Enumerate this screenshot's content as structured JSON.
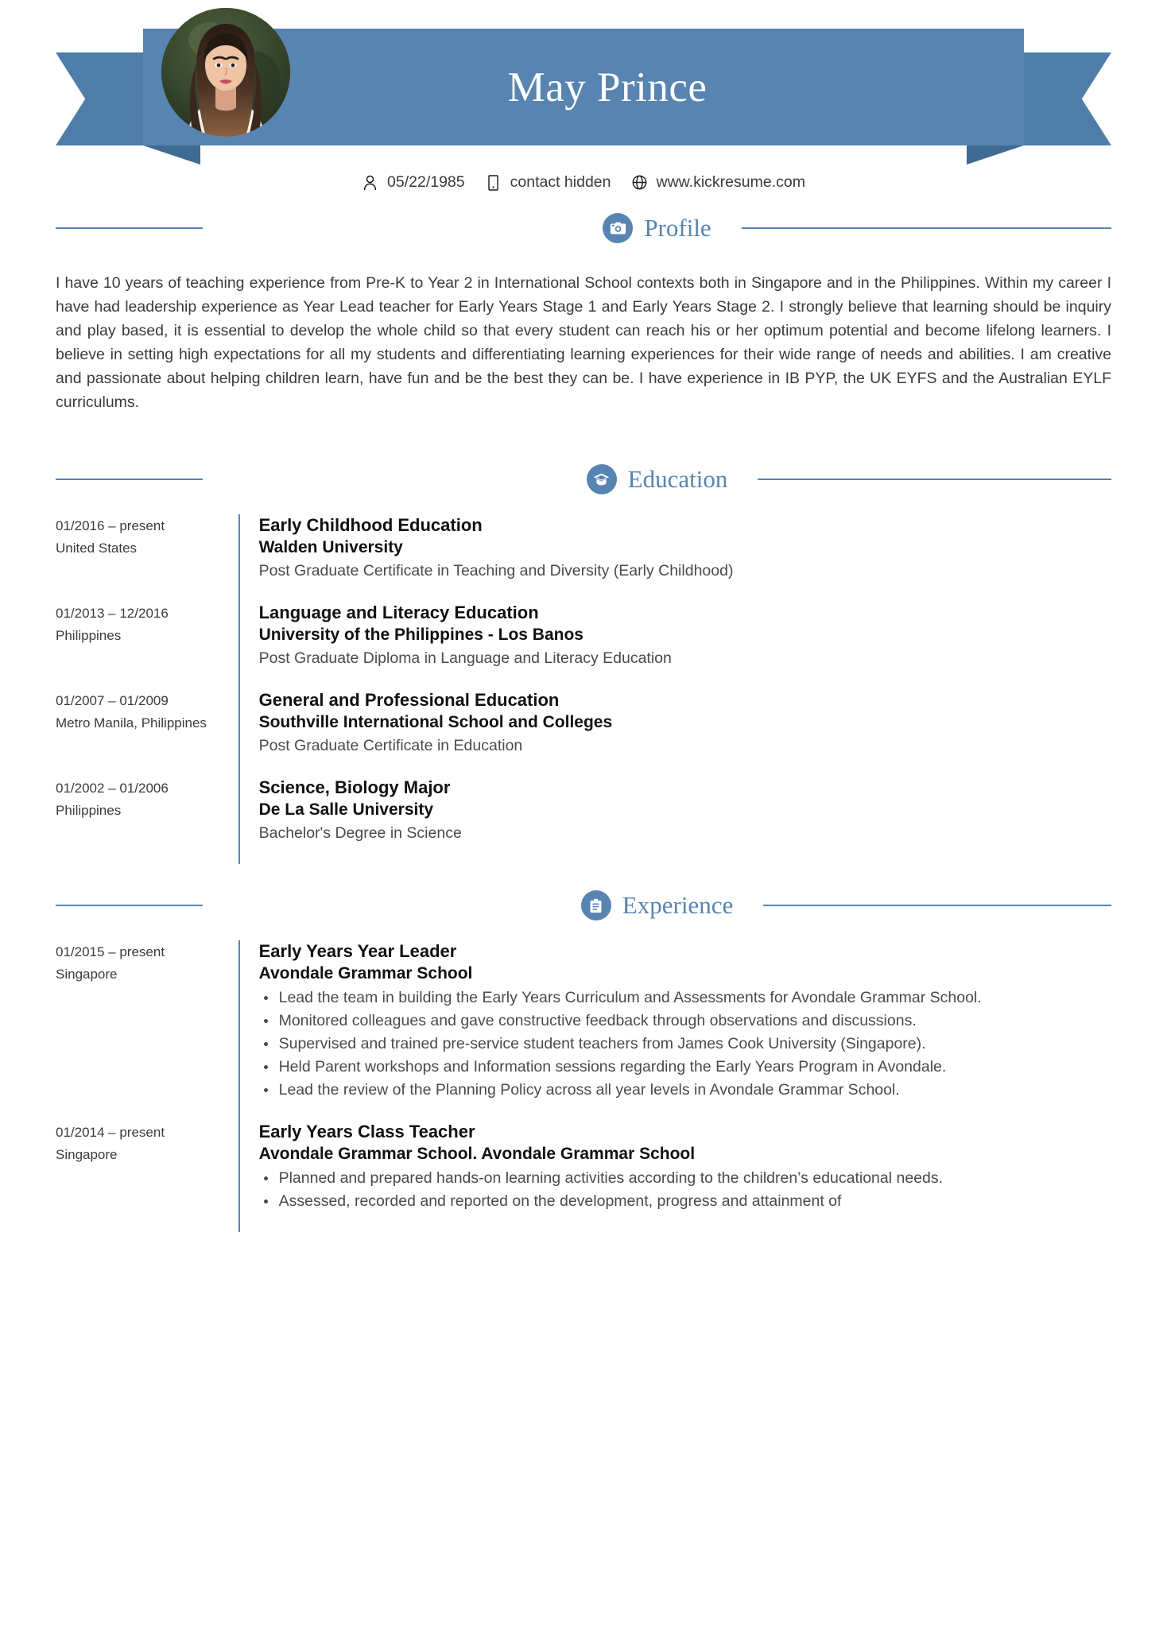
{
  "colors": {
    "accent": "#5784b0",
    "ribbon_dark": "#4f7daa",
    "ribbon_shadow": "#3f6a93",
    "text": "#3b3b3b",
    "heading": "#111111"
  },
  "header": {
    "name": "May Prince",
    "avatar_alt": "profile-photo"
  },
  "contact": [
    {
      "icon": "person-icon",
      "value": "05/22/1985"
    },
    {
      "icon": "phone-icon",
      "value": "contact hidden"
    },
    {
      "icon": "globe-icon",
      "value": "www.kickresume.com"
    }
  ],
  "sections": {
    "profile": {
      "title": "Profile",
      "icon": "camera-icon",
      "text": "I have 10 years of teaching experience from Pre-K to Year 2 in International School contexts both in Singapore and in the Philippines. Within my career I have had leadership experience as Year Lead teacher for Early Years Stage 1 and Early Years Stage 2. I strongly believe that learning should be inquiry and play based, it is essential to develop the whole child so that every student can reach his or her optimum potential and become lifelong learners. I believe in setting high expectations for all my students and differentiating learning experiences for their wide range of needs and abilities. I am creative and passionate about helping children learn, have fun and be the best they can be. I have experience in IB PYP, the UK EYFS and the Australian EYLF curriculums."
    },
    "education": {
      "title": "Education",
      "icon": "graduation-cap-icon",
      "items": [
        {
          "period": "01/2016 – present",
          "location": "United States",
          "title": "Early Childhood Education",
          "organization": "Walden University",
          "subtitle": "Post Graduate Certificate in Teaching and Diversity (Early Childhood)"
        },
        {
          "period": "01/2013 – 12/2016",
          "location": "Philippines",
          "title": "Language and Literacy Education",
          "organization": "University of the Philippines - Los Banos",
          "subtitle": "Post Graduate Diploma in Language and Literacy Education"
        },
        {
          "period": "01/2007 – 01/2009",
          "location": "Metro Manila, Philippines",
          "title": "General and Professional Education",
          "organization": "Southville International School and Colleges",
          "subtitle": "Post Graduate Certificate in Education"
        },
        {
          "period": "01/2002 – 01/2006",
          "location": "Philippines",
          "title": "Science, Biology Major",
          "organization": "De La Salle University",
          "subtitle": "Bachelor's Degree in Science"
        }
      ]
    },
    "experience": {
      "title": "Experience",
      "icon": "briefcase-icon",
      "items": [
        {
          "period": "01/2015 – present",
          "location": "Singapore",
          "title": "Early Years Year Leader",
          "organization": "Avondale Grammar School",
          "bullets": [
            "Lead the team in building the Early Years Curriculum and Assessments for Avondale Grammar School.",
            "Monitored colleagues and gave constructive feedback through observations and discussions.",
            "Supervised and trained pre-service student teachers from James Cook University (Singapore).",
            "Held Parent workshops and Information sessions regarding the Early Years Program in Avondale.",
            "Lead the review of the Planning Policy across all year levels in Avondale Grammar School."
          ]
        },
        {
          "period": "01/2014 – present",
          "location": "Singapore",
          "title": "Early Years Class Teacher",
          "organization": "Avondale Grammar School. Avondale Grammar School",
          "bullets": [
            "Planned and prepared hands-on learning activities according to the children’s educational needs.",
            "Assessed, recorded and reported on the development, progress and attainment of"
          ]
        }
      ]
    }
  }
}
